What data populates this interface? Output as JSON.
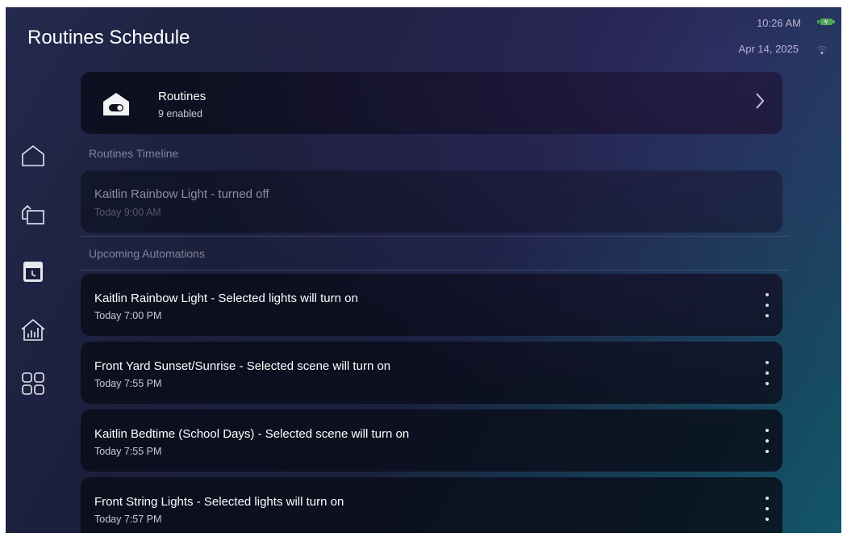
{
  "header": {
    "title": "Routines Schedule",
    "time": "10:26 AM",
    "date": "Apr 14, 2025",
    "battery_color": "#4cd33d"
  },
  "nav": {
    "items": [
      {
        "name": "home",
        "icon": "home-icon"
      },
      {
        "name": "devices",
        "icon": "devices-icon"
      },
      {
        "name": "schedule",
        "icon": "calendar-clock-icon",
        "active": true
      },
      {
        "name": "energy",
        "icon": "house-chart-icon"
      },
      {
        "name": "apps",
        "icon": "grid-icon"
      }
    ]
  },
  "routines_card": {
    "title": "Routines",
    "subtitle": "9 enabled"
  },
  "timeline": {
    "heading": "Routines Timeline",
    "items": [
      {
        "title": "Kaitlin Rainbow Light - turned off",
        "time": "Today 9:00 AM"
      }
    ]
  },
  "upcoming": {
    "heading": "Upcoming Automations",
    "items": [
      {
        "title": "Kaitlin Rainbow Light - Selected lights will turn on",
        "time": "Today 7:00 PM"
      },
      {
        "title": "Front Yard Sunset/Sunrise - Selected scene will turn on",
        "time": "Today 7:55 PM"
      },
      {
        "title": "Kaitlin Bedtime (School Days) - Selected scene will turn on",
        "time": "Today 7:55 PM"
      },
      {
        "title": "Front String Lights - Selected lights will turn on",
        "time": "Today 7:57 PM"
      }
    ]
  }
}
